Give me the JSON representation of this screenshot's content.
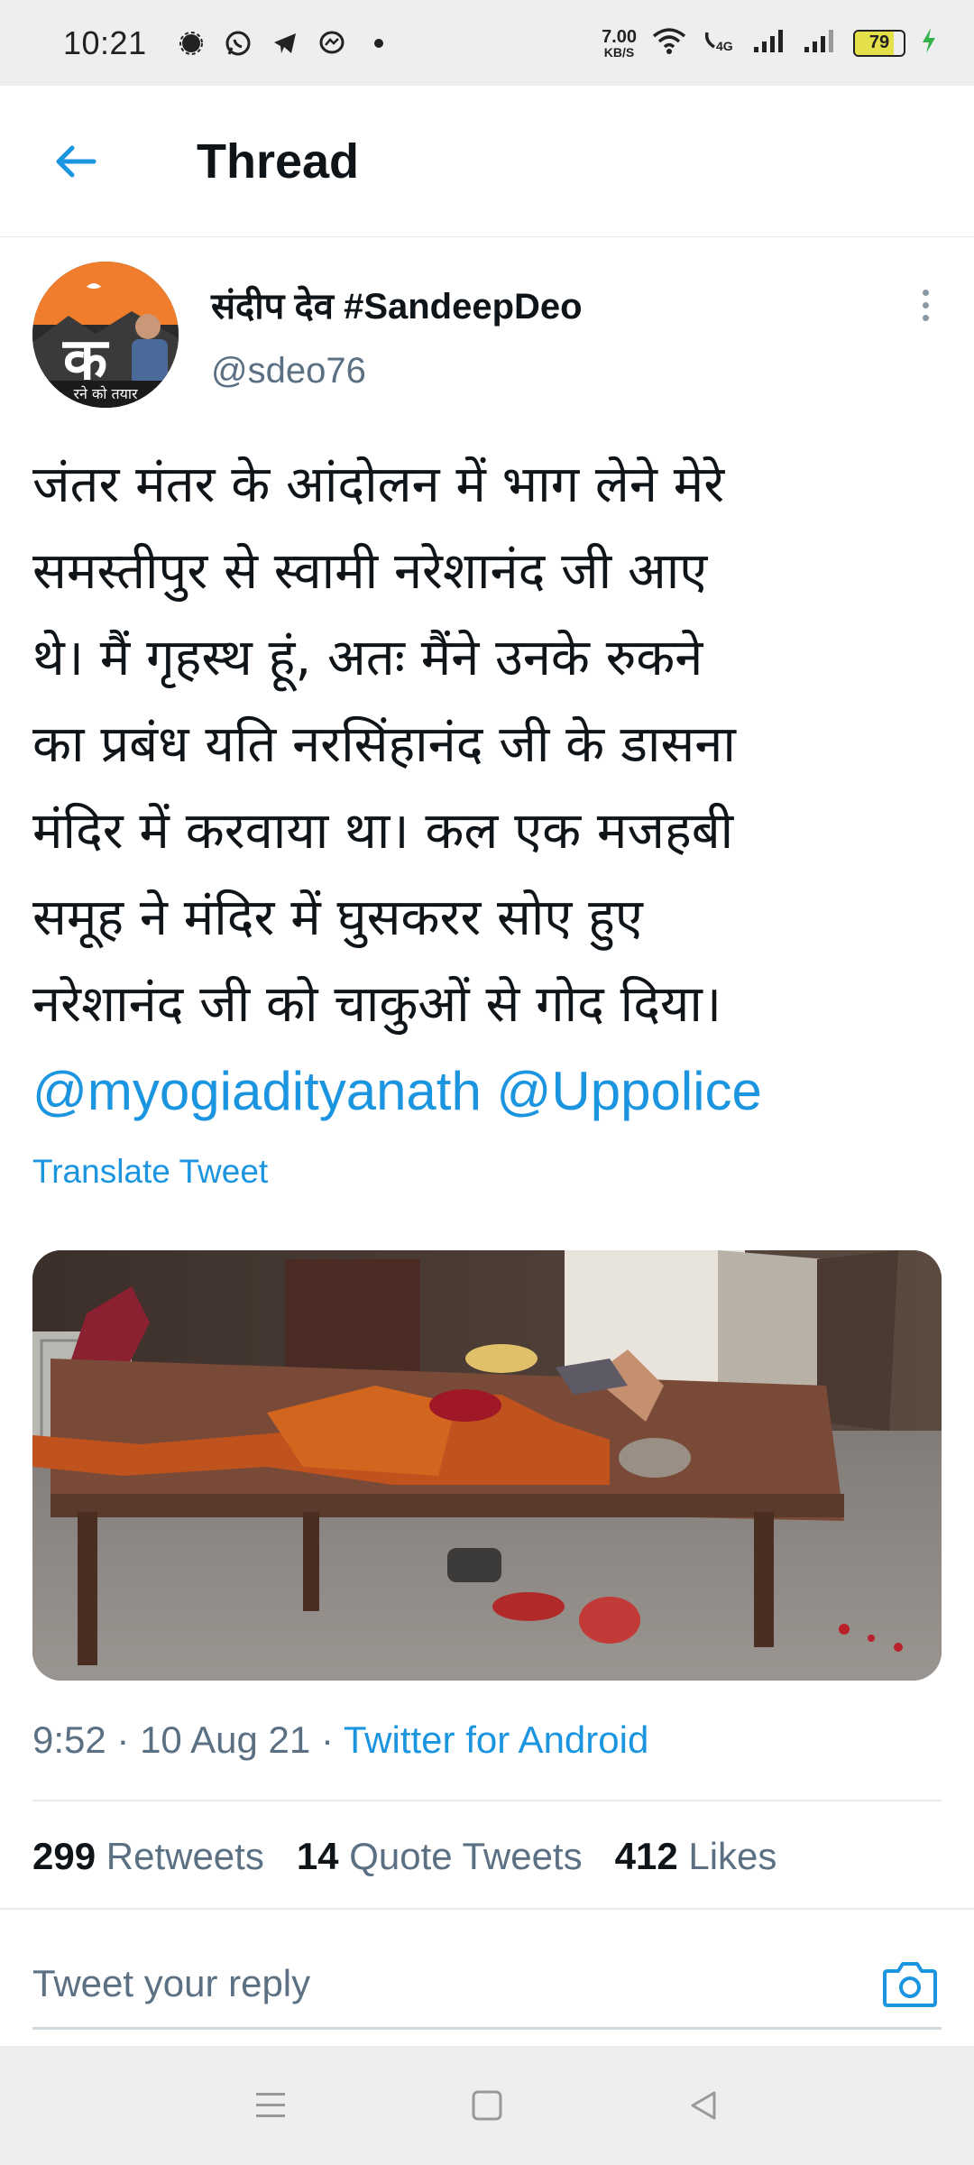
{
  "status_bar": {
    "time": "10:21",
    "net_speed_value": "7.00",
    "net_speed_unit": "KB/S",
    "battery_level": "79",
    "battery_fraction": 0.79,
    "left_icons": [
      "sync-icon",
      "whatsapp-icon",
      "telegram-icon",
      "messenger-icon",
      "dot-icon"
    ],
    "right_icons": [
      "wifi-icon",
      "volte-icon",
      "signal-icon",
      "signal-icon",
      "battery-icon",
      "charging-icon"
    ]
  },
  "header": {
    "title": "Thread",
    "back_icon": "arrow-left-icon"
  },
  "tweet": {
    "display_name": "संदीप देव #SandeepDeo",
    "handle": "@sdeo76",
    "avatar_caption": "रने को तयार",
    "text_lines": [
      "जंतर मंतर के आंदोलन में भाग लेने मेरे",
      "समस्तीपुर से स्वामी नरेशानंद जी आए",
      "थे। मैं गृहस्थ हूं, अतः मैंने उनके रुकने",
      "का प्रबंध यति नरसिंहानंद जी के डासना",
      "मंदिर में करवाया था। कल एक मजहबी",
      "समूह ने मंदिर में घुसकरर सोए हुए",
      "नरेशानंद जी को चाकुओं से गोद दिया।"
    ],
    "mentions": "@myogiadityanath @Uppolice",
    "translate_label": "Translate Tweet",
    "time": "9:52",
    "date": "10 Aug 21",
    "source": "Twitter for Android",
    "stats": {
      "retweets_count": "299",
      "retweets_label": "Retweets",
      "quotes_count": "14",
      "quotes_label": "Quote Tweets",
      "likes_count": "412",
      "likes_label": "Likes"
    }
  },
  "reply": {
    "placeholder": "Tweet your reply",
    "camera_icon": "camera-icon"
  },
  "nav": {
    "icons": [
      "menu-icon",
      "home-square-icon",
      "back-triangle-icon"
    ]
  },
  "colors": {
    "accent": "#1b95e0",
    "text": "#0f1419",
    "secondary": "#5b7083",
    "system_bar": "#eeeeee"
  }
}
